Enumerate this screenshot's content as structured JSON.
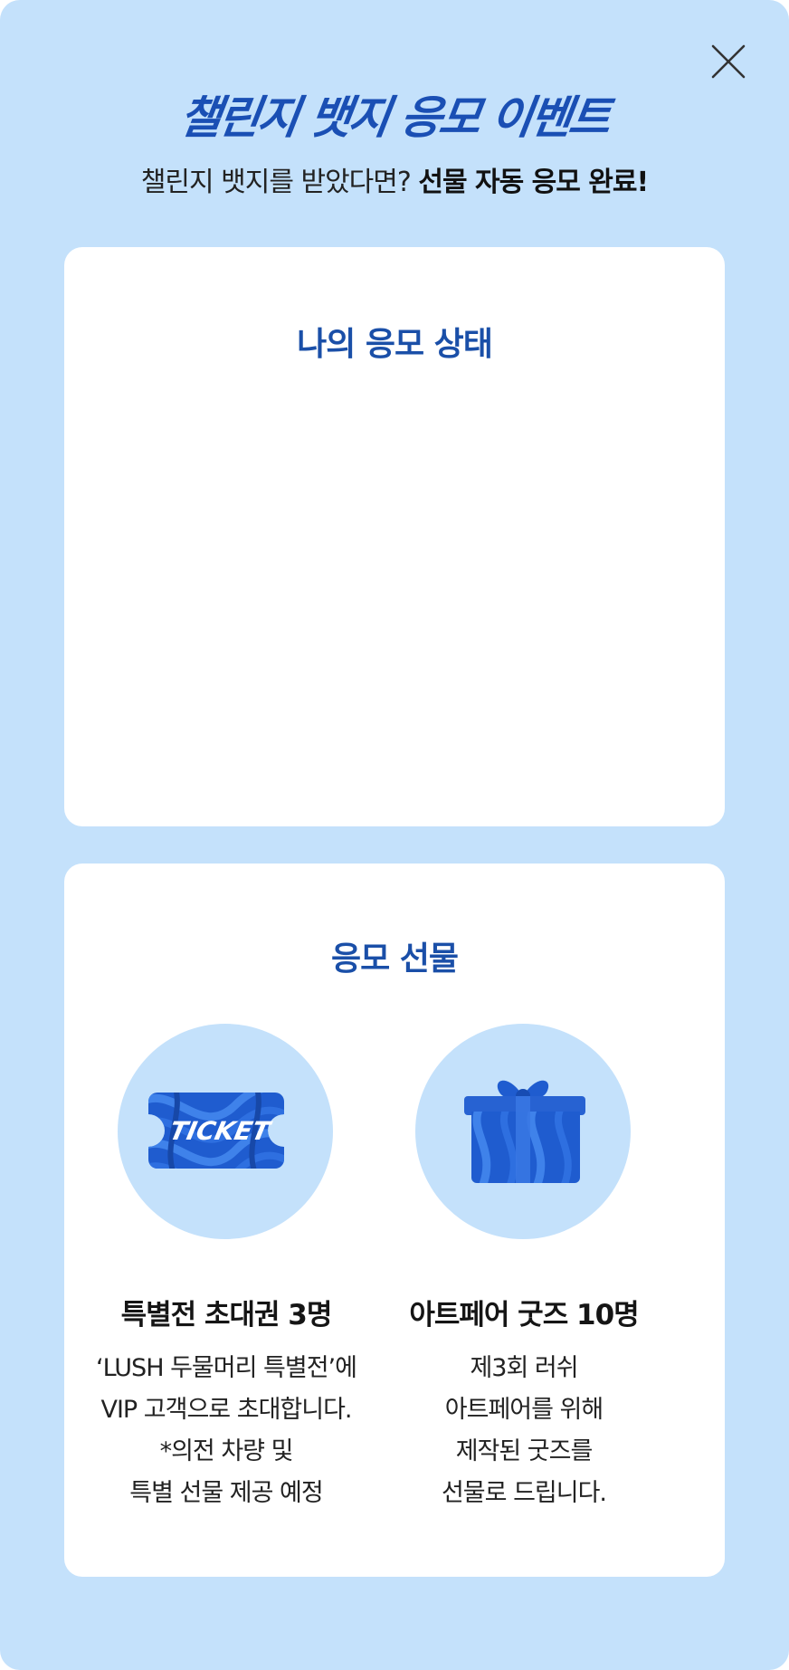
{
  "header": {
    "title": "챌린지 뱃지 응모 이벤트",
    "subtitle_normal": "챌린지 뱃지를 받았다면? ",
    "subtitle_bold": "선물 자동 응모 완료!"
  },
  "close": {
    "icon": "close-icon"
  },
  "status_card": {
    "title": "나의 응모 상태"
  },
  "prizes_card": {
    "title": "응모 선물",
    "items": [
      {
        "icon": "ticket-icon",
        "icon_text": "TICKET",
        "name": "특별전 초대권 3명",
        "desc": [
          "‘LUSH 두물머리 특별전’에",
          "VIP 고객으로 초대합니다.",
          "*의전 차량 및",
          "특별 선물 제공 예정"
        ]
      },
      {
        "icon": "gift-box-icon",
        "name": "아트페어 굿즈 10명",
        "desc": [
          "제3회 러쉬",
          "아트페어를 위해",
          "제작된 굿즈를",
          "선물로 드립니다."
        ]
      }
    ]
  },
  "colors": {
    "background": "#c4e1fb",
    "accent": "#1a4fb4",
    "card": "#ffffff"
  }
}
